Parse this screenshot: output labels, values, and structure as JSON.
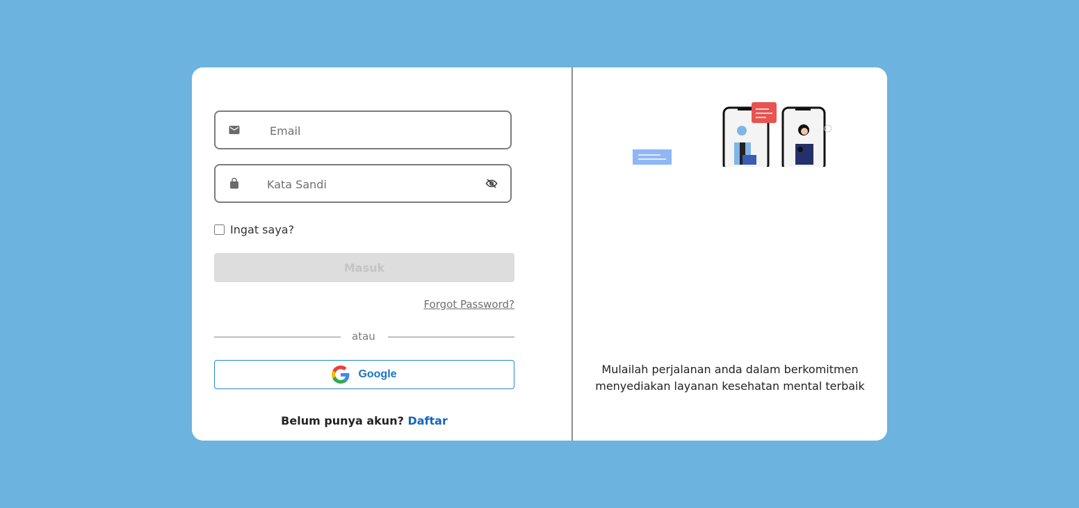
{
  "login": {
    "email_placeholder": "Email",
    "password_placeholder": "Kata Sandi",
    "remember_label": "Ingat saya?",
    "submit_label": "Masuk",
    "forgot_label": "Forgot Password?",
    "or_label": "atau",
    "google_label": "Google",
    "signup_prompt": "Belum punya akun?",
    "signup_link": "Daftar"
  },
  "promo": {
    "tagline_line1": "Mulailah perjalanan anda dalam berkomitmen",
    "tagline_line2": "menyediakan layanan kesehatan mental terbaik"
  },
  "icons": {
    "email": "mail-icon",
    "password": "lock-icon",
    "visibility": "eye-off-icon",
    "google": "google-logo-icon"
  },
  "colors": {
    "background": "#6cb3df",
    "card": "#ffffff",
    "button_disabled": "#dddddd",
    "google_border": "#1e88c9",
    "google_text": "#1a73c8",
    "link": "#1565c0"
  }
}
